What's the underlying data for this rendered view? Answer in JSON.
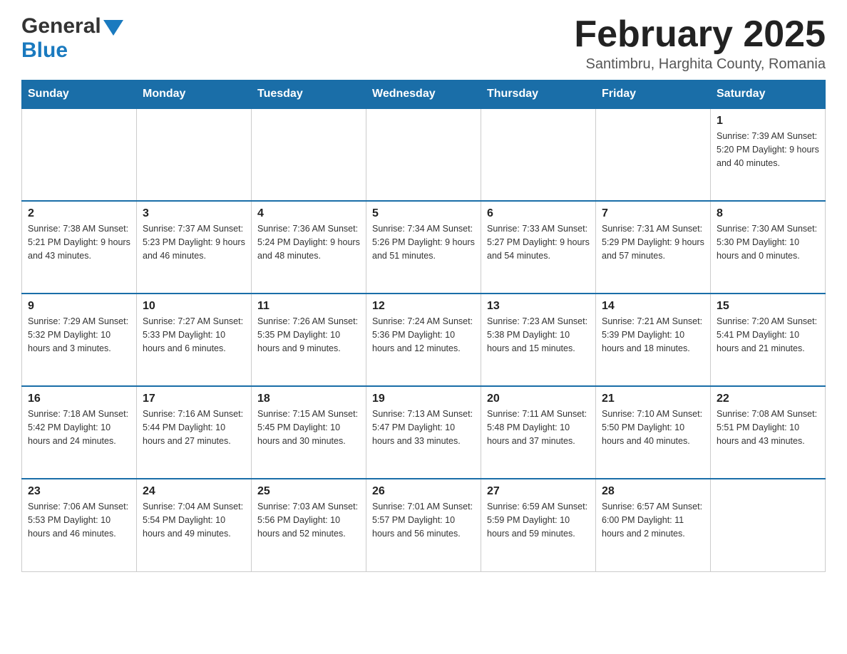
{
  "header": {
    "logo": {
      "general": "General",
      "blue": "Blue"
    },
    "title": "February 2025",
    "location": "Santimbru, Harghita County, Romania"
  },
  "calendar": {
    "days": [
      "Sunday",
      "Monday",
      "Tuesday",
      "Wednesday",
      "Thursday",
      "Friday",
      "Saturday"
    ],
    "weeks": [
      {
        "cells": [
          {
            "day": "",
            "info": ""
          },
          {
            "day": "",
            "info": ""
          },
          {
            "day": "",
            "info": ""
          },
          {
            "day": "",
            "info": ""
          },
          {
            "day": "",
            "info": ""
          },
          {
            "day": "",
            "info": ""
          },
          {
            "day": "1",
            "info": "Sunrise: 7:39 AM\nSunset: 5:20 PM\nDaylight: 9 hours and 40 minutes."
          }
        ]
      },
      {
        "cells": [
          {
            "day": "2",
            "info": "Sunrise: 7:38 AM\nSunset: 5:21 PM\nDaylight: 9 hours and 43 minutes."
          },
          {
            "day": "3",
            "info": "Sunrise: 7:37 AM\nSunset: 5:23 PM\nDaylight: 9 hours and 46 minutes."
          },
          {
            "day": "4",
            "info": "Sunrise: 7:36 AM\nSunset: 5:24 PM\nDaylight: 9 hours and 48 minutes."
          },
          {
            "day": "5",
            "info": "Sunrise: 7:34 AM\nSunset: 5:26 PM\nDaylight: 9 hours and 51 minutes."
          },
          {
            "day": "6",
            "info": "Sunrise: 7:33 AM\nSunset: 5:27 PM\nDaylight: 9 hours and 54 minutes."
          },
          {
            "day": "7",
            "info": "Sunrise: 7:31 AM\nSunset: 5:29 PM\nDaylight: 9 hours and 57 minutes."
          },
          {
            "day": "8",
            "info": "Sunrise: 7:30 AM\nSunset: 5:30 PM\nDaylight: 10 hours and 0 minutes."
          }
        ]
      },
      {
        "cells": [
          {
            "day": "9",
            "info": "Sunrise: 7:29 AM\nSunset: 5:32 PM\nDaylight: 10 hours and 3 minutes."
          },
          {
            "day": "10",
            "info": "Sunrise: 7:27 AM\nSunset: 5:33 PM\nDaylight: 10 hours and 6 minutes."
          },
          {
            "day": "11",
            "info": "Sunrise: 7:26 AM\nSunset: 5:35 PM\nDaylight: 10 hours and 9 minutes."
          },
          {
            "day": "12",
            "info": "Sunrise: 7:24 AM\nSunset: 5:36 PM\nDaylight: 10 hours and 12 minutes."
          },
          {
            "day": "13",
            "info": "Sunrise: 7:23 AM\nSunset: 5:38 PM\nDaylight: 10 hours and 15 minutes."
          },
          {
            "day": "14",
            "info": "Sunrise: 7:21 AM\nSunset: 5:39 PM\nDaylight: 10 hours and 18 minutes."
          },
          {
            "day": "15",
            "info": "Sunrise: 7:20 AM\nSunset: 5:41 PM\nDaylight: 10 hours and 21 minutes."
          }
        ]
      },
      {
        "cells": [
          {
            "day": "16",
            "info": "Sunrise: 7:18 AM\nSunset: 5:42 PM\nDaylight: 10 hours and 24 minutes."
          },
          {
            "day": "17",
            "info": "Sunrise: 7:16 AM\nSunset: 5:44 PM\nDaylight: 10 hours and 27 minutes."
          },
          {
            "day": "18",
            "info": "Sunrise: 7:15 AM\nSunset: 5:45 PM\nDaylight: 10 hours and 30 minutes."
          },
          {
            "day": "19",
            "info": "Sunrise: 7:13 AM\nSunset: 5:47 PM\nDaylight: 10 hours and 33 minutes."
          },
          {
            "day": "20",
            "info": "Sunrise: 7:11 AM\nSunset: 5:48 PM\nDaylight: 10 hours and 37 minutes."
          },
          {
            "day": "21",
            "info": "Sunrise: 7:10 AM\nSunset: 5:50 PM\nDaylight: 10 hours and 40 minutes."
          },
          {
            "day": "22",
            "info": "Sunrise: 7:08 AM\nSunset: 5:51 PM\nDaylight: 10 hours and 43 minutes."
          }
        ]
      },
      {
        "cells": [
          {
            "day": "23",
            "info": "Sunrise: 7:06 AM\nSunset: 5:53 PM\nDaylight: 10 hours and 46 minutes."
          },
          {
            "day": "24",
            "info": "Sunrise: 7:04 AM\nSunset: 5:54 PM\nDaylight: 10 hours and 49 minutes."
          },
          {
            "day": "25",
            "info": "Sunrise: 7:03 AM\nSunset: 5:56 PM\nDaylight: 10 hours and 52 minutes."
          },
          {
            "day": "26",
            "info": "Sunrise: 7:01 AM\nSunset: 5:57 PM\nDaylight: 10 hours and 56 minutes."
          },
          {
            "day": "27",
            "info": "Sunrise: 6:59 AM\nSunset: 5:59 PM\nDaylight: 10 hours and 59 minutes."
          },
          {
            "day": "28",
            "info": "Sunrise: 6:57 AM\nSunset: 6:00 PM\nDaylight: 11 hours and 2 minutes."
          },
          {
            "day": "",
            "info": ""
          }
        ]
      }
    ]
  }
}
